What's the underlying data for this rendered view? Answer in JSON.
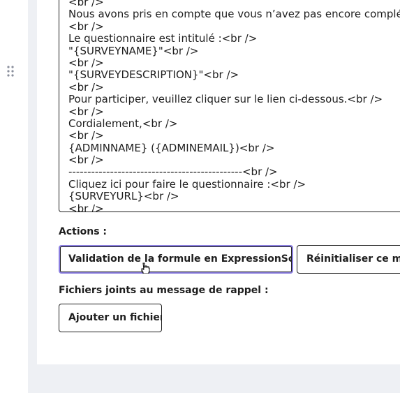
{
  "editor": {
    "lines": [
      "<br />",
      "Nous avons pris en compte que vous n’avez pas encore complété",
      "<br />",
      "Le questionnaire est intitulé :<br />",
      "\"{SURVEYNAME}\"<br />",
      "<br />",
      "\"{SURVEYDESCRIPTION}\"<br />",
      "<br />",
      "Pour participer, veuillez cliquer sur le lien ci-dessous.<br />",
      "<br />",
      "Cordialement,<br />",
      "<br />",
      "{ADMINNAME} ({ADMINEMAIL})<br />",
      "<br />",
      "----------------------------------------------<br />",
      "Cliquez ici pour faire le questionnaire :<br />",
      "{SURVEYURL}<br />",
      "<br />"
    ]
  },
  "actions": {
    "label": "Actions :",
    "validate_button": "Validation de la formule en ExpressionScript",
    "reset_button": "Réinitialiser ce modèle"
  },
  "attachments": {
    "label": "Fichiers joints au message de rappel :",
    "add_button": "Ajouter un fichier"
  },
  "icons": {
    "drag_handle": "drag-handle-icon",
    "cursor": "hand-pointer-icon"
  }
}
